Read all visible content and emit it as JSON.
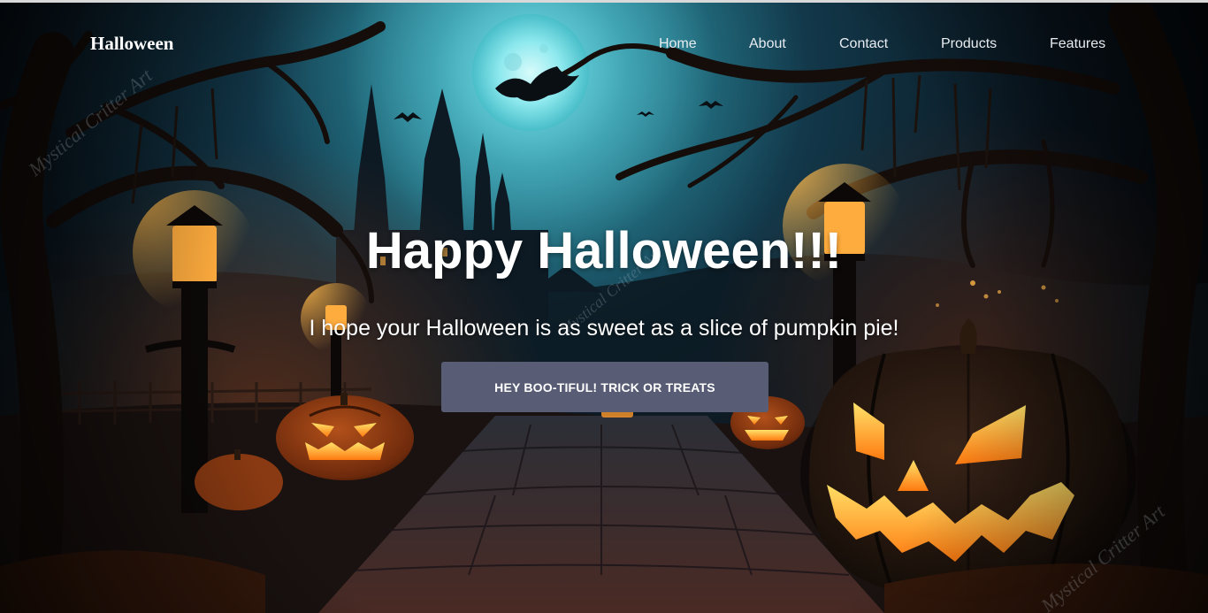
{
  "navbar": {
    "brand": "Halloween",
    "links": [
      {
        "label": "Home"
      },
      {
        "label": "About"
      },
      {
        "label": "Contact"
      },
      {
        "label": "Products"
      },
      {
        "label": "Features"
      }
    ]
  },
  "hero": {
    "title": "Happy Halloween!!!",
    "subtitle": "I hope your Halloween is as sweet as a slice of pumpkin pie!",
    "cta_label": "HEY BOO-TIFUL! TRICK OR TREATS"
  },
  "watermark": "Mystical Critter Art",
  "colors": {
    "button_bg": "#585d75",
    "text": "#ffffff",
    "moon_glow": "#7fe3ea",
    "pumpkin_orange": "#e8651a",
    "pumpkin_glow": "#ffb21e"
  }
}
